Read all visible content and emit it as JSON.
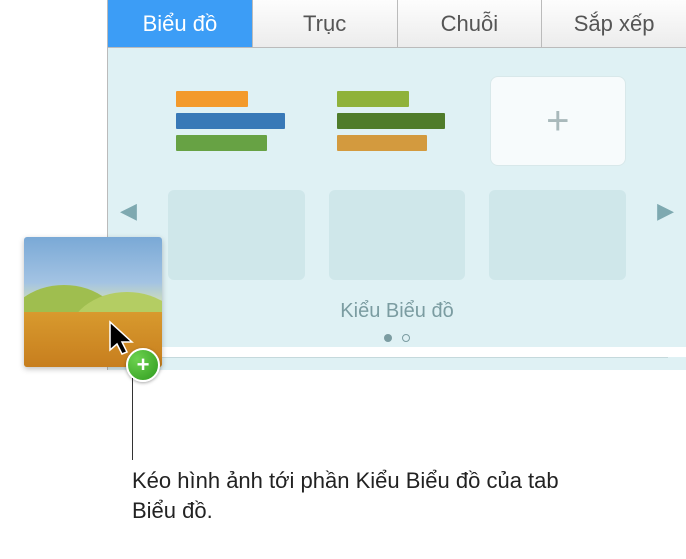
{
  "tabs": {
    "chart": "Biểu đồ",
    "axis": "Trục",
    "series": "Chuỗi",
    "arrange": "Sắp xếp"
  },
  "styles": {
    "section_label": "Kiểu Biểu đồ",
    "preset_a": {
      "bar1_color": "#f39a2b",
      "bar2_color": "#3879b7",
      "bar3_color": "#67a244"
    },
    "preset_b": {
      "bar1_color": "#8fb23a",
      "bar2_color": "#4f7c2a",
      "bar3_color": "#d39a3e"
    }
  },
  "caption": "Kéo hình ảnh tới phần Kiểu Biểu đồ của tab Biểu đồ.",
  "icons": {
    "plus": "+",
    "left_arrow": "◀",
    "right_arrow": "▶"
  }
}
